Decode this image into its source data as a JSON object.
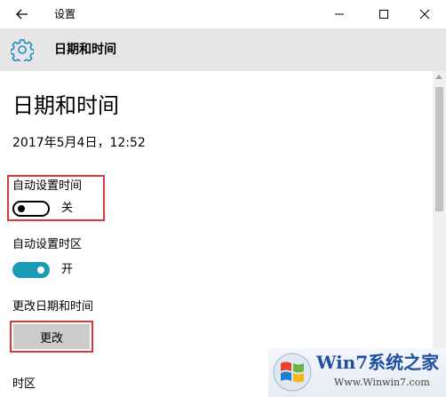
{
  "window": {
    "title": "设置"
  },
  "header": {
    "title": "日期和时间",
    "icon": "gear-icon"
  },
  "main": {
    "page_title": "日期和时间",
    "current_datetime": "2017年5月4日，12:52",
    "auto_time": {
      "label": "自动设置时间",
      "state_label": "关",
      "on": false
    },
    "auto_timezone": {
      "label": "自动设置时区",
      "state_label": "开",
      "on": true
    },
    "change_datetime": {
      "label": "更改日期和时间",
      "button_label": "更改"
    },
    "timezone": {
      "label": "时区"
    }
  },
  "watermark": {
    "brand": "Win7系统之家",
    "url": "Www.Winwin7.com"
  },
  "colors": {
    "accent": "#1a9bb8",
    "highlight_box": "#d9393b",
    "header_bg": "#e6e6e6"
  }
}
